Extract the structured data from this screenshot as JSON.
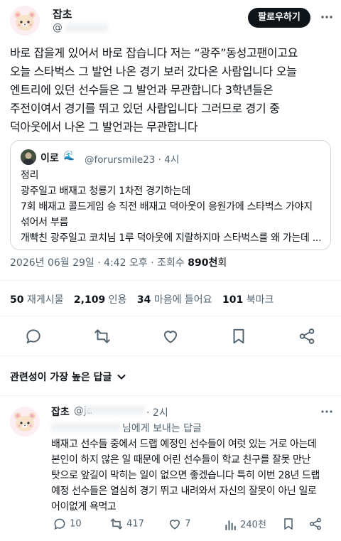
{
  "tweet": {
    "author_name": "잡초",
    "author_handle": "@",
    "follow_label": "팔로우하기",
    "text_lines": [
      "바로 잡을게 있어서 바로 잡습니다 저는 “광주”동성고팬이고요",
      "오늘 스타벅스 그 발언 나온 경기 보러 갔다온 사람입니다 오늘",
      "엔트리에 있던 선수들은 그 발언과 무관합니다 3학년들은",
      "주전이여서 경기를 뛰고 있던 사람입니다 그러므로 경기 중",
      "덕아웃에서 나온 그 발언과는 무관합니다"
    ]
  },
  "quote": {
    "name": "이로",
    "wave_icon": "🌊",
    "handle": "@forursmile23",
    "separator": "·",
    "time": "4시",
    "lines": [
      "정리",
      "광주일고 배재고 청룡기 1차전 경기하는데",
      "7회 배재고 콜드게임 승 직전 배재고 덕아웃이 응원가에 스타벅스 가야지",
      "섞어서 부름",
      "개빡친 광주일고 코치님 1루 덕아웃에 지랄하지마 스타벅스를 왜 가는데 ..."
    ]
  },
  "timestamp": {
    "date_time": "2026년 06월 29일 · 4:42 오후 · 조회수 ",
    "views_num": "890천",
    "views_suffix": "회"
  },
  "stats": [
    {
      "num": "50",
      "label": "재게시물"
    },
    {
      "num": "2,109",
      "label": "인용"
    },
    {
      "num": "34",
      "label": "마음에 들어요"
    },
    {
      "num": "101",
      "label": "북마크"
    }
  ],
  "sort": {
    "label": "관련성이 가장 높은 답글"
  },
  "reply": {
    "author_name": "잡초",
    "author_handle": "@ja",
    "separator": "·",
    "time": "2시",
    "replying_label": "님에게 보내는 답글",
    "text_lines": [
      "배재고 선수들 중에서 드랩 예정인 선수들이 여럿 있는 거로 아는데",
      "본인이 하지 않은 일 때문에 어린 선수들이 학교 친구를 잘못 만난",
      "탓으로 앞길이 막히는 일이 없으면 좋겠습니다 특히 이번 28년 드랩",
      "예정 선수들은 열심히 경기 뛰고 내려와서 자신의 잘못이 아닌 일로",
      "어이없게 욕먹고"
    ],
    "replies": "10",
    "reposts": "417",
    "likes": "7",
    "views": "240천"
  },
  "colors": {
    "text": "#0f1419",
    "muted": "#536471",
    "border": "#cfd9de",
    "accent": "#1d9bf0",
    "follow_bg": "#0f1419"
  },
  "icons": [
    "more-icon",
    "reply-icon",
    "repost-icon",
    "like-icon",
    "bookmark-icon",
    "share-icon",
    "views-icon",
    "chevron-down-icon",
    "wave-emoji-icon"
  ]
}
